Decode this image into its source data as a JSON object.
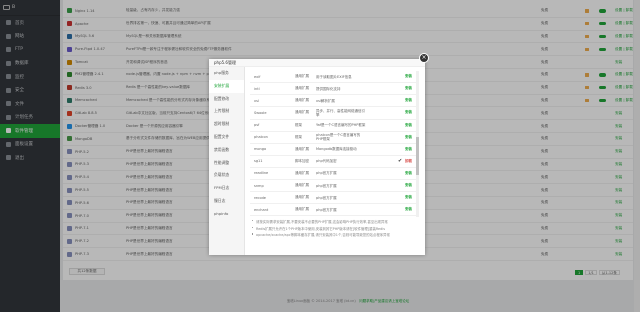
{
  "sidebar": {
    "brand": "B",
    "items": [
      {
        "label": "首页",
        "active": false
      },
      {
        "label": "网站",
        "active": false
      },
      {
        "label": "FTP",
        "active": false
      },
      {
        "label": "数据库",
        "active": false
      },
      {
        "label": "监控",
        "active": false
      },
      {
        "label": "安全",
        "active": false
      },
      {
        "label": "文件",
        "active": false
      },
      {
        "label": "计划任务",
        "active": false
      },
      {
        "label": "软件管理",
        "active": true
      },
      {
        "label": "面板设置",
        "active": false
      },
      {
        "label": "退出",
        "active": false
      }
    ]
  },
  "software": {
    "rows": [
      {
        "name": "Nginx 1.14",
        "desc": "轻量级，占有内存少，并发能力强",
        "price": "免费",
        "color": "#3aa04a",
        "ops": "设置 | 卸载"
      },
      {
        "name": "Apache",
        "desc": "世界排名第一，快速、可靠并且可通过简单的API扩展",
        "price": "免费",
        "color": "#c33",
        "ops": "设置 | 卸载"
      },
      {
        "name": "MySQL 5.6",
        "desc": "MySQL是一种关系数据库管理系统",
        "price": "免费",
        "color": "#2b6fa8",
        "ops": "设置 | 卸载"
      },
      {
        "name": "Pure-Ftpd 1.0.47",
        "desc": "PureFTPd是一款专注于程序健壮和软件安全的免费FTP服务器软件",
        "price": "免费",
        "color": "#6a5acd",
        "ops": "设置 | 卸载"
      },
      {
        "name": "Tomcat",
        "desc": "开发和调试JSP程序的首选",
        "price": "免费",
        "color": "#d38b00",
        "ops": "安装"
      },
      {
        "name": "PM2管理器 2.4.1",
        "desc": "node.js管理器，内置 node.js + npm + nvm + pm2",
        "price": "免费",
        "color": "#2f8b2f",
        "ops": "设置 | 卸载"
      },
      {
        "name": "Redis 3.0",
        "desc": "Redis 是一个高性能的key-value数据库",
        "price": "免费",
        "color": "#c0392b",
        "ops": "设置 | 卸载"
      },
      {
        "name": "Memcached",
        "desc": "Memcached 是一个高性能的分布式内存对象缓存系统",
        "price": "免费",
        "color": "#2e7d6b",
        "ops": "设置 | 卸载"
      },
      {
        "name": "GitLab 8.8.5",
        "desc": "GitLab中文社区版，当前只支持Centos6/7 64位系统",
        "price": "免费",
        "color": "#e24329",
        "ops": "安装"
      },
      {
        "name": "Docker管理器 1.0",
        "desc": "Docker 是一个开源的应用容器引擎",
        "price": "免费",
        "color": "#2496ed",
        "ops": "安装"
      },
      {
        "name": "MongoDB",
        "desc": "基于分布式文件存储的数据库，旨在为WEB应用提供",
        "price": "免费",
        "color": "#4a9b4a",
        "ops": "安装"
      },
      {
        "name": "PHP-5.2",
        "desc": "PHP是世界上最好的编程语言",
        "price": "免费",
        "color": "#8892bf",
        "ops": "安装"
      },
      {
        "name": "PHP-5.3",
        "desc": "PHP是世界上最好的编程语言",
        "price": "免费",
        "color": "#8892bf",
        "ops": "安装"
      },
      {
        "name": "PHP-5.4",
        "desc": "PHP是世界上最好的编程语言",
        "price": "免费",
        "color": "#8892bf",
        "ops": "安装"
      },
      {
        "name": "PHP-5.5",
        "desc": "PHP是世界上最好的编程语言",
        "price": "免费",
        "color": "#8892bf",
        "ops": "安装"
      },
      {
        "name": "PHP-5.6",
        "desc": "PHP是世界上最好的编程语言",
        "price": "免费",
        "color": "#8892bf",
        "ops": "安装"
      },
      {
        "name": "PHP-7.0",
        "desc": "PHP是世界上最好的编程语言",
        "price": "免费",
        "color": "#8892bf",
        "ops": "安装"
      },
      {
        "name": "PHP-7.1",
        "desc": "PHP是世界上最好的编程语言",
        "price": "免费",
        "color": "#8892bf",
        "ops": "安装"
      },
      {
        "name": "PHP-7.2",
        "desc": "PHP是世界上最好的编程语言",
        "price": "免费",
        "color": "#8892bf",
        "ops": "安装"
      },
      {
        "name": "PHP-7.3",
        "desc": "PHP是世界上最好的编程语言",
        "price": "免费",
        "color": "#8892bf",
        "ops": "安装"
      }
    ],
    "count": "共12条数据",
    "pager": [
      "1",
      "1/1",
      "从1-12条"
    ]
  },
  "footer": {
    "copy": "宝塔Linux面板 © 2014-2017 宝塔 (bt.cn)",
    "link": "问题求助|产品建议请上宝塔论坛"
  },
  "dialog": {
    "title": "php5.6管理",
    "close": "×",
    "nav": [
      {
        "label": "php服务",
        "active": false
      },
      {
        "label": "安装扩展",
        "active": true
      },
      {
        "label": "配置修改",
        "active": false
      },
      {
        "label": "上传限制",
        "active": false
      },
      {
        "label": "超时限制",
        "active": false
      },
      {
        "label": "配置文件",
        "active": false
      },
      {
        "label": "禁用函数",
        "active": false
      },
      {
        "label": "性能调整",
        "active": false
      },
      {
        "label": "负载状态",
        "active": false
      },
      {
        "label": "FPM日志",
        "active": false
      },
      {
        "label": "慢日志",
        "active": false
      },
      {
        "label": "phpinfo",
        "active": false
      }
    ],
    "extensions": [
      {
        "name": "exif",
        "type": "通用扩展",
        "desc": "用于读取图片EXIF信息",
        "status": "",
        "action": "安装",
        "kind": "ins"
      },
      {
        "name": "intl",
        "type": "通用扩展",
        "desc": "提供国际化支持",
        "status": "",
        "action": "安装",
        "kind": "ins"
      },
      {
        "name": "xsl",
        "type": "通用扩展",
        "desc": "xsl解析扩展",
        "status": "",
        "action": "安装",
        "kind": "ins"
      },
      {
        "name": "Swoole",
        "type": "通用扩展",
        "desc": "异步、并行、高性能网络通信引擎",
        "status": "",
        "action": "安装",
        "kind": "ins"
      },
      {
        "name": "psf",
        "type": "框架",
        "desc": "Yaf是一个C语言编写的PHP框架",
        "status": "",
        "action": "安装",
        "kind": "ins"
      },
      {
        "name": "phalcon",
        "type": "框架",
        "desc": "phalcon是一个C语言编写的PHP框架",
        "status": "",
        "action": "安装",
        "kind": "ins"
      },
      {
        "name": "mongo",
        "type": "通用扩展",
        "desc": "Mongodb数据库连接驱动",
        "status": "",
        "action": "安装",
        "kind": "ins"
      },
      {
        "name": "sg11",
        "type": "脚本加密",
        "desc": "php代码加密",
        "status": "✔",
        "action": "卸载",
        "kind": "del"
      },
      {
        "name": "readline",
        "type": "通用扩展",
        "desc": "php官方扩展",
        "status": "",
        "action": "安装",
        "kind": "ins"
      },
      {
        "name": "snmp",
        "type": "通用扩展",
        "desc": "php官方扩展",
        "status": "",
        "action": "安装",
        "kind": "ins"
      },
      {
        "name": "recode",
        "type": "通用扩展",
        "desc": "php官方扩展",
        "status": "",
        "action": "安装",
        "kind": "ins"
      },
      {
        "name": "enchant",
        "type": "通用扩展",
        "desc": "php官方扩展",
        "status": "",
        "action": "安装",
        "kind": "ins"
      }
    ],
    "notes": [
      "请按实际需求安装扩展,不要安装不必要的PHP扩展,这会影响PHP执行效率,甚至出现异常",
      "Redis扩展只允许在1个PHP版本中使用,安装到其它PHP版本请在[软件管理]重装Redis",
      "opcache/xcache/apc等脚本缓存扩展,请只安装其中1个,否则可能导致您的站点程序异常"
    ]
  }
}
